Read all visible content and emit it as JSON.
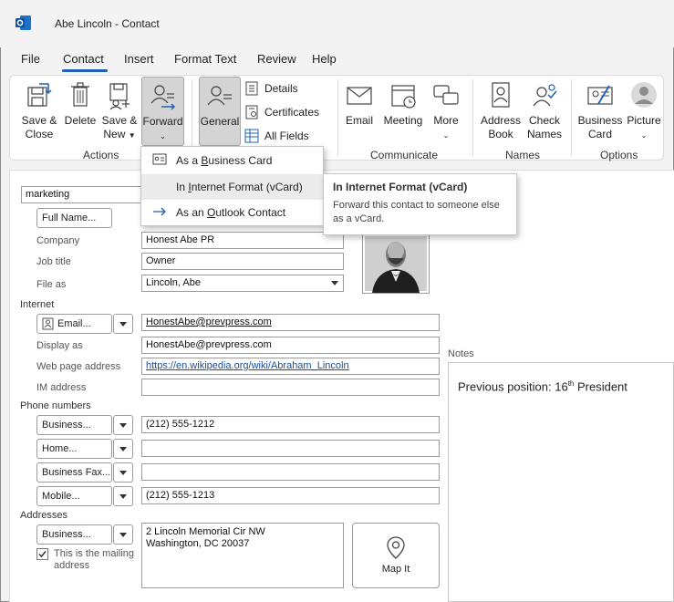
{
  "window": {
    "title": "Abe Lincoln  -  Contact",
    "app_icon": "outlook-logo"
  },
  "menu": {
    "items": [
      {
        "label": "File"
      },
      {
        "label": "Contact"
      },
      {
        "label": "Insert"
      },
      {
        "label": "Format Text"
      },
      {
        "label": "Review"
      },
      {
        "label": "Help"
      }
    ],
    "active": "Contact"
  },
  "ribbon": {
    "actions": {
      "label": "Actions",
      "save_close": [
        "Save &",
        "Close"
      ],
      "delete": "Delete",
      "save_new": [
        "Save &",
        "New"
      ],
      "forward": "Forward"
    },
    "show": {
      "general": "General",
      "details": "Details",
      "certificates": "Certificates",
      "all_fields": "All Fields"
    },
    "communicate": {
      "label": "Communicate",
      "email": "Email",
      "meeting": "Meeting",
      "more": "More"
    },
    "names": {
      "label": "Names",
      "address_book": [
        "Address",
        "Book"
      ],
      "check_names": [
        "Check",
        "Names"
      ]
    },
    "options": {
      "label": "Options",
      "business_card": [
        "Business",
        "Card"
      ],
      "picture": "Picture"
    }
  },
  "forward_menu": {
    "items": [
      {
        "pre": "As a ",
        "key": "B",
        "post": "usiness Card"
      },
      {
        "pre": "In ",
        "key": "I",
        "post": "nternet Format (vCard)"
      },
      {
        "pre": "As an ",
        "key": "O",
        "post": "utlook Contact"
      }
    ],
    "hovered": 1
  },
  "tooltip": {
    "title": "In Internet Format (vCard)",
    "body": "Forward this contact to someone else as a vCard."
  },
  "form": {
    "category_value": "marketing",
    "full_name_button": "Full Name...",
    "company_label": "Company",
    "company_value": "Honest Abe PR",
    "job_title_label": "Job title",
    "job_title_value": "Owner",
    "file_as_label": "File as",
    "file_as_value": "Lincoln, Abe",
    "internet_label": "Internet",
    "email_button": "Email...",
    "email_value": "HonestAbe@prevpress.com",
    "display_as_label": "Display as",
    "display_as_value": "HonestAbe@prevpress.com",
    "web_label": "Web page address",
    "web_value": "https://en.wikipedia.org/wiki/Abraham_Lincoln",
    "im_label": "IM address",
    "im_value": "",
    "phone_label": "Phone numbers",
    "phones": [
      {
        "button": "Business...",
        "value": "(212) 555-1212"
      },
      {
        "button": "Home...",
        "value": ""
      },
      {
        "button": "Business Fax...",
        "value": ""
      },
      {
        "button": "Mobile...",
        "value": "(212) 555-1213"
      }
    ],
    "addresses_label": "Addresses",
    "address_button": "Business...",
    "address_value": "2 Lincoln Memorial Cir NW\nWashington, DC  20037",
    "mailing_checkbox_label": "This is the mailing address",
    "mailing_checked": true,
    "map_it": "Map It",
    "notes_label": "Notes",
    "notes_text": "Previous position: 16",
    "notes_sup": "th",
    "notes_tail": " President"
  }
}
